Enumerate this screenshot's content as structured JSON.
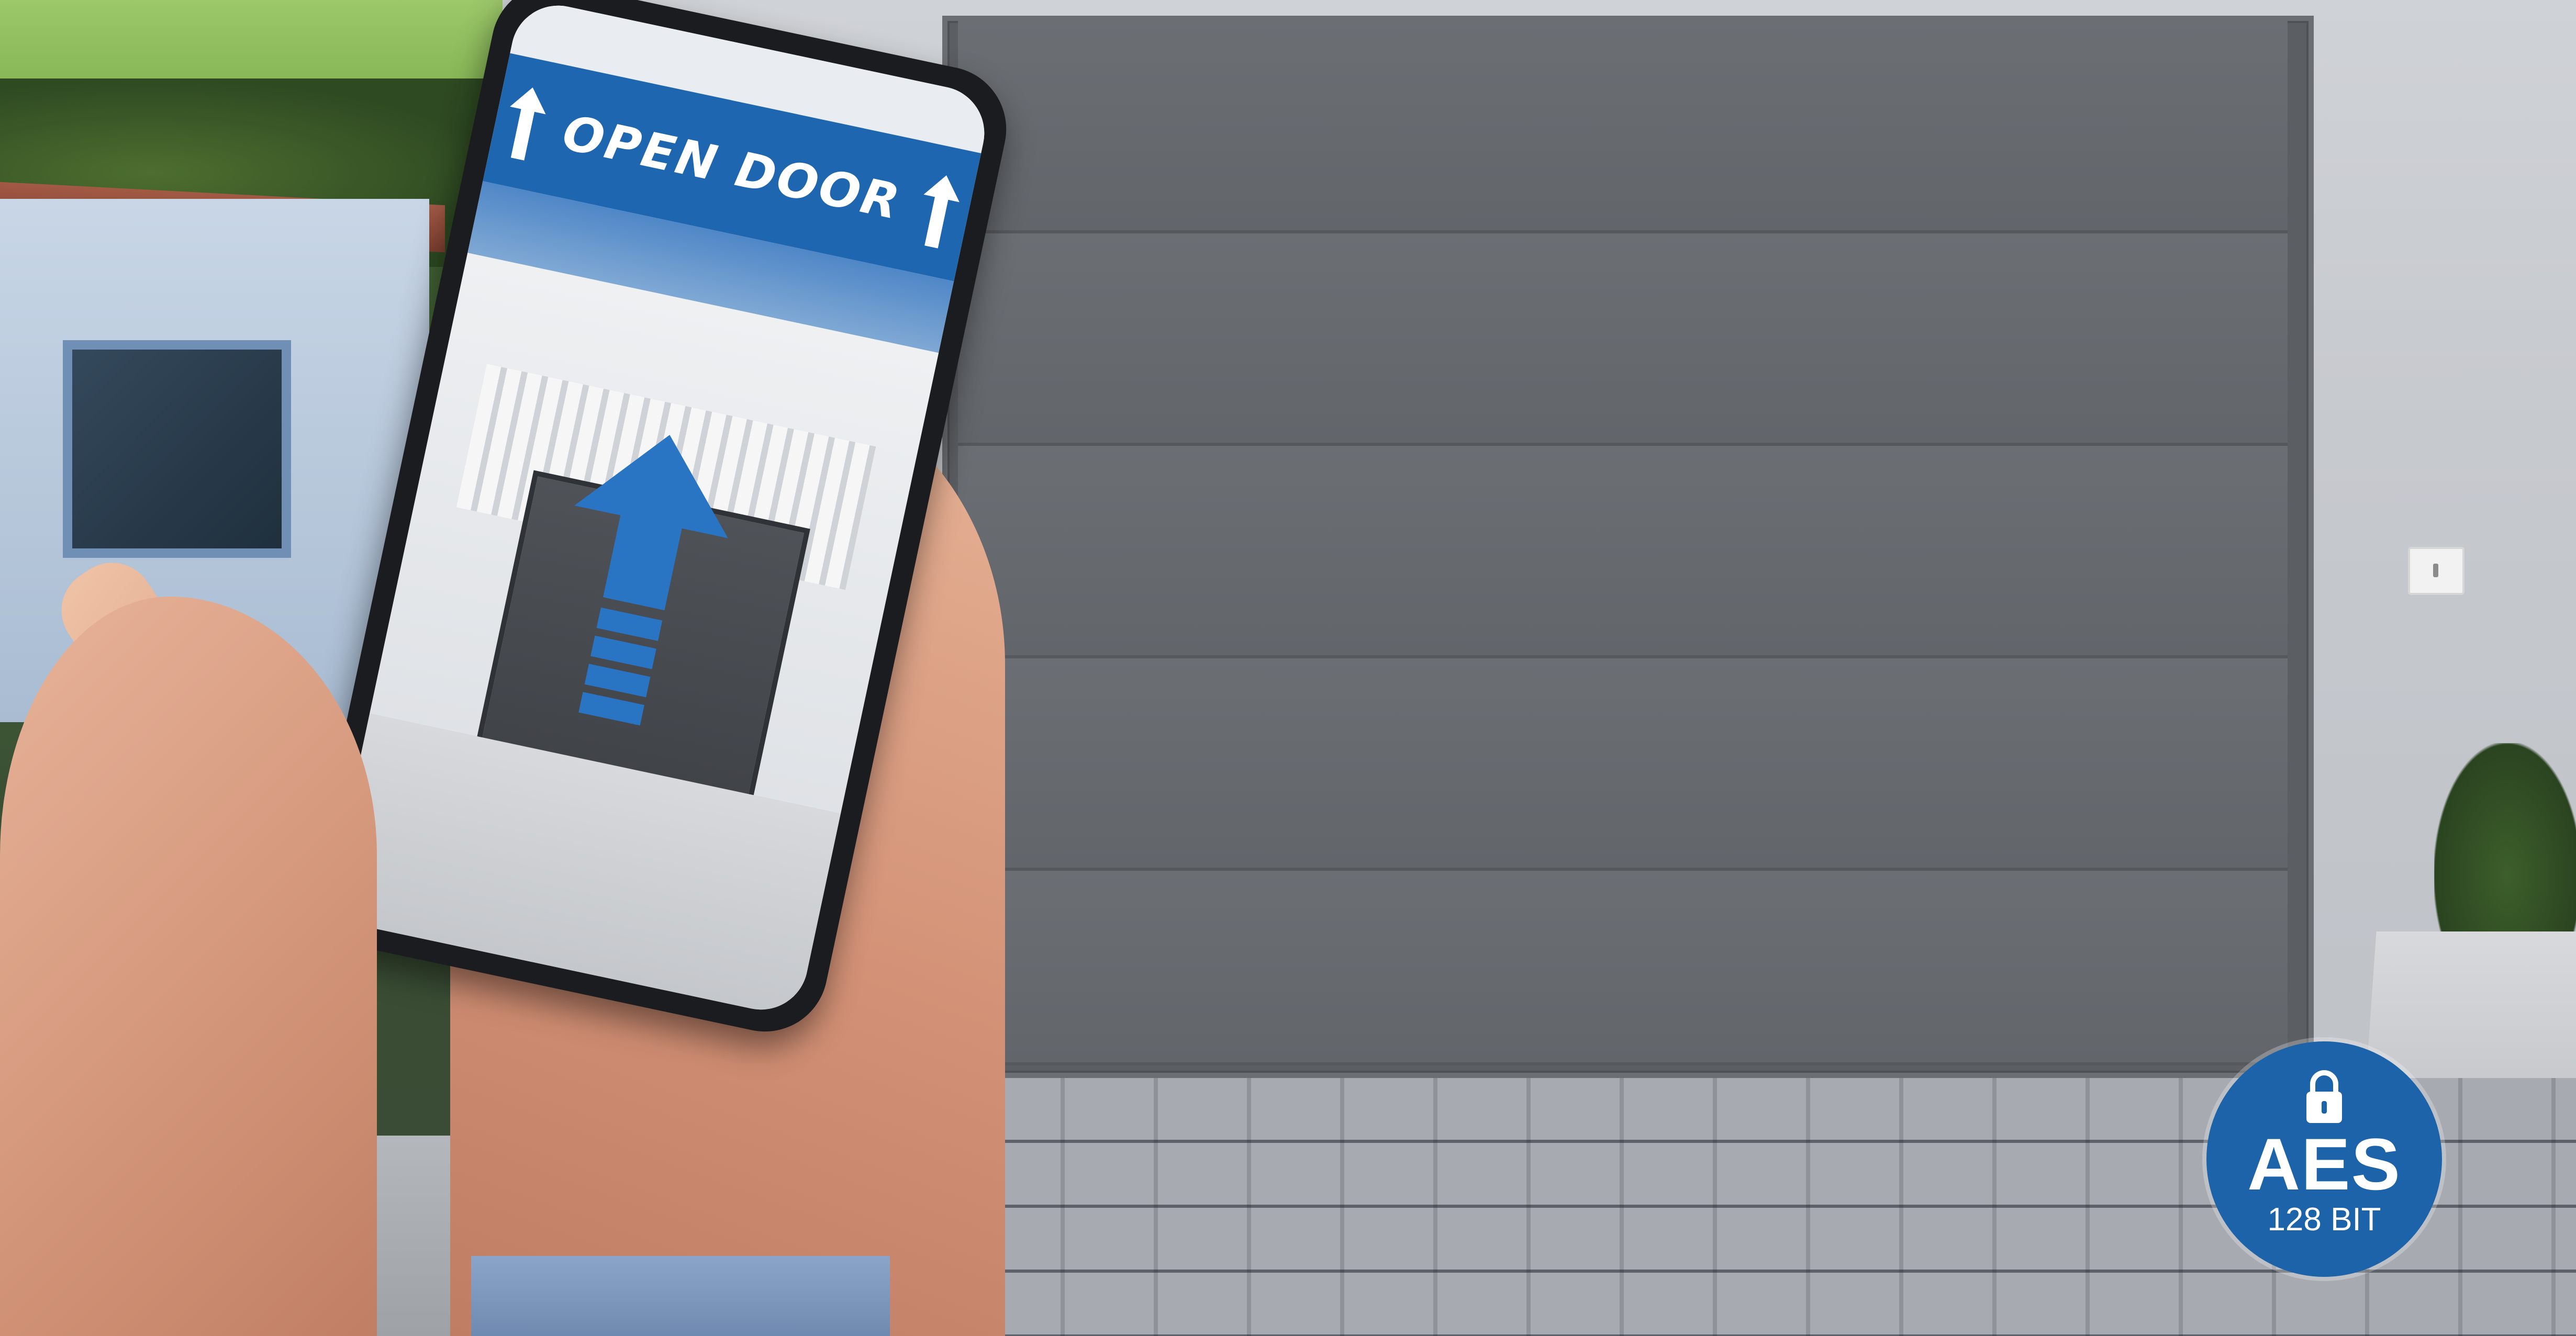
{
  "phone_app": {
    "banner_label": "OPEN DOOR",
    "banner_color": "#1e67b0",
    "arrow_icon": "up-arrow-icon",
    "big_arrow_icon": "up-arrow-stack-icon"
  },
  "security_badge": {
    "title": "AES",
    "subtitle": "128 BIT",
    "icon": "lock-icon",
    "color": "#1c63aa"
  },
  "scene": {
    "door_color": "#676b70",
    "wall_color": "#c9cdd2"
  }
}
